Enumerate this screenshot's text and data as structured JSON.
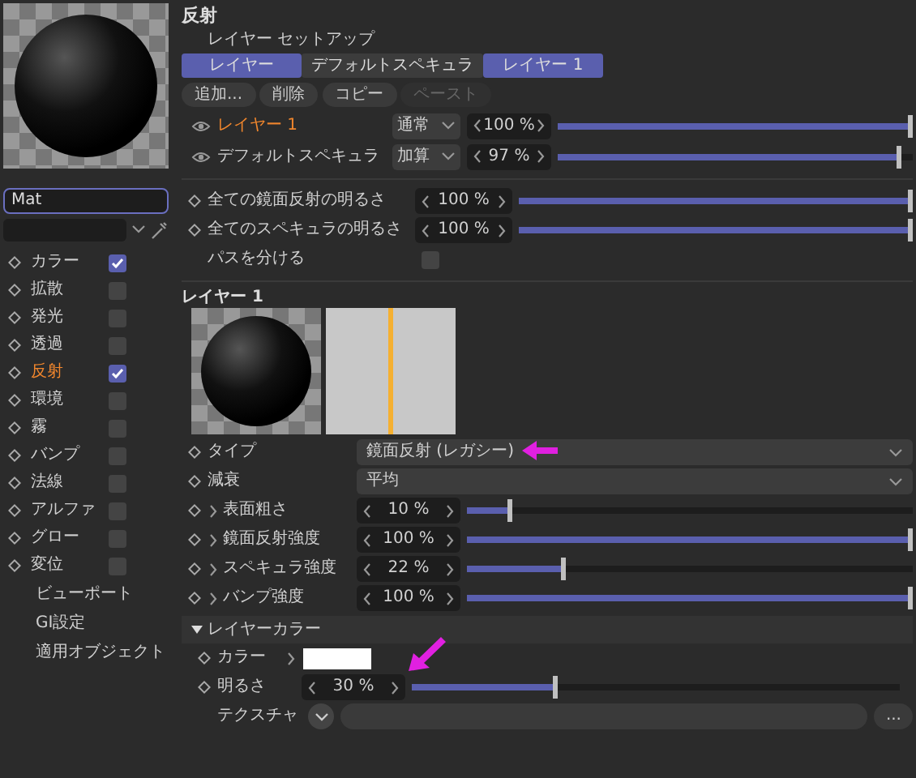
{
  "material": {
    "name": "Mat"
  },
  "channels": [
    {
      "label": "カラー",
      "checked": true,
      "selected": false
    },
    {
      "label": "拡散",
      "checked": false,
      "selected": false
    },
    {
      "label": "発光",
      "checked": false,
      "selected": false
    },
    {
      "label": "透過",
      "checked": false,
      "selected": false
    },
    {
      "label": "反射",
      "checked": true,
      "selected": true
    },
    {
      "label": "環境",
      "checked": false,
      "selected": false
    },
    {
      "label": "霧",
      "checked": false,
      "selected": false
    },
    {
      "label": "バンプ",
      "checked": false,
      "selected": false
    },
    {
      "label": "法線",
      "checked": false,
      "selected": false
    },
    {
      "label": "アルファ",
      "checked": false,
      "selected": false
    },
    {
      "label": "グロー",
      "checked": false,
      "selected": false
    },
    {
      "label": "変位",
      "checked": false,
      "selected": false
    }
  ],
  "extra_items": [
    "ビューポート",
    "GI設定",
    "適用オブジェクト"
  ],
  "section_title": "反射",
  "setup_label": "レイヤー セットアップ",
  "tabs": [
    {
      "label": "レイヤー",
      "selected": true
    },
    {
      "label": "デフォルトスペキュラ",
      "selected": false
    },
    {
      "label": "レイヤー 1",
      "selected": true
    }
  ],
  "buttons": [
    {
      "label": "追加...",
      "disabled": false
    },
    {
      "label": "削除",
      "disabled": false
    },
    {
      "label": "コピー",
      "disabled": false
    },
    {
      "label": "ペースト",
      "disabled": true
    }
  ],
  "layers": [
    {
      "name": "レイヤー 1",
      "selected": true,
      "mode": "通常",
      "value": "100 %",
      "level": 1
    },
    {
      "name": "デフォルトスペキュラ",
      "selected": false,
      "mode": "加算",
      "value": "97 %",
      "level": 0.97
    }
  ],
  "global": [
    {
      "kind": "slider",
      "label": "全ての鏡面反射の明るさ",
      "value": "100 %",
      "level": 1
    },
    {
      "kind": "slider",
      "label": "全てのスペキュラの明るさ",
      "value": "100 %",
      "level": 1
    },
    {
      "kind": "checkbox",
      "label": "パスを分ける",
      "checked": false
    }
  ],
  "layer_section": {
    "title": "レイヤー 1",
    "params": [
      {
        "kind": "dropdown",
        "label": "タイプ",
        "value": "鏡面反射 (レガシー)"
      },
      {
        "kind": "dropdown",
        "label": "減衰",
        "value": "平均"
      },
      {
        "kind": "slider",
        "label": "表面粗さ",
        "value": "10 %",
        "level": 0.1
      },
      {
        "kind": "slider",
        "label": "鏡面反射強度",
        "value": "100 %",
        "level": 1
      },
      {
        "kind": "slider",
        "label": "スペキュラ強度",
        "value": "22 %",
        "level": 0.22
      },
      {
        "kind": "slider",
        "label": "バンプ強度",
        "value": "100 %",
        "level": 1
      }
    ]
  },
  "layer_color": {
    "title": "レイヤーカラー",
    "color_label": "カラー",
    "color": "#ffffff",
    "brightness": {
      "label": "明るさ",
      "value": "30 %",
      "level": 0.3
    },
    "texture_label": "テクスチャ",
    "more_button": "..."
  }
}
